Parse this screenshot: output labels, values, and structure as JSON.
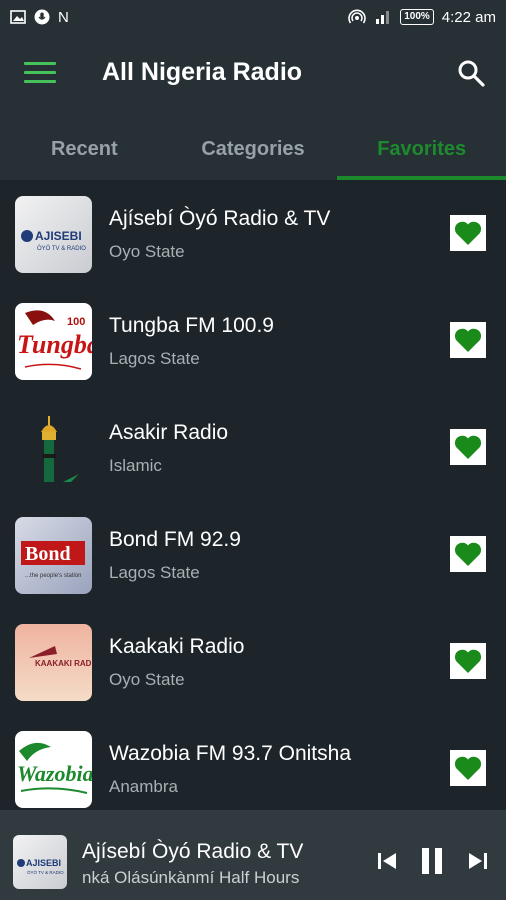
{
  "status_bar": {
    "carrier_letter": "N",
    "battery": "100%",
    "time": "4:22 am"
  },
  "app_bar": {
    "title": "All Nigeria Radio"
  },
  "tabs": [
    {
      "label": "Recent",
      "active": false
    },
    {
      "label": "Categories",
      "active": false
    },
    {
      "label": "Favorites",
      "active": true
    }
  ],
  "stations": [
    {
      "name": "Ajísebí Òyó Radio & TV",
      "region": "Oyo State",
      "logo_text": "AJISEBI",
      "logo_sub": "ÒYÓ TV & RADIO",
      "favorite": true
    },
    {
      "name": "Tungba FM 100.9",
      "region": "Lagos State",
      "logo_text": "Tungba",
      "logo_num": "100",
      "favorite": true
    },
    {
      "name": "Asakir Radio",
      "region": "Islamic",
      "favorite": true
    },
    {
      "name": "Bond FM 92.9",
      "region": "Lagos State",
      "logo_text": "Bond",
      "logo_sub": "...the people's station",
      "favorite": true
    },
    {
      "name": "Kaakaki Radio",
      "region": "Oyo State",
      "logo_text": "KAAKAKI RADIO",
      "favorite": true
    },
    {
      "name": "Wazobia FM 93.7 Onitsha",
      "region": "Anambra",
      "logo_text": "Wazobia",
      "favorite": true
    }
  ],
  "player": {
    "station": "Ajísebí Òyó Radio & TV",
    "now_playing": "nká Olásúnkànmí Half Hours",
    "logo_text": "AJISEBI",
    "logo_sub": "ÒYÓ TV & RADIO"
  },
  "colors": {
    "accent": "#1d8a2d",
    "menu": "#46c25a",
    "heart": "#1a8a1a",
    "background": "#1e252a",
    "bar": "#263035"
  }
}
